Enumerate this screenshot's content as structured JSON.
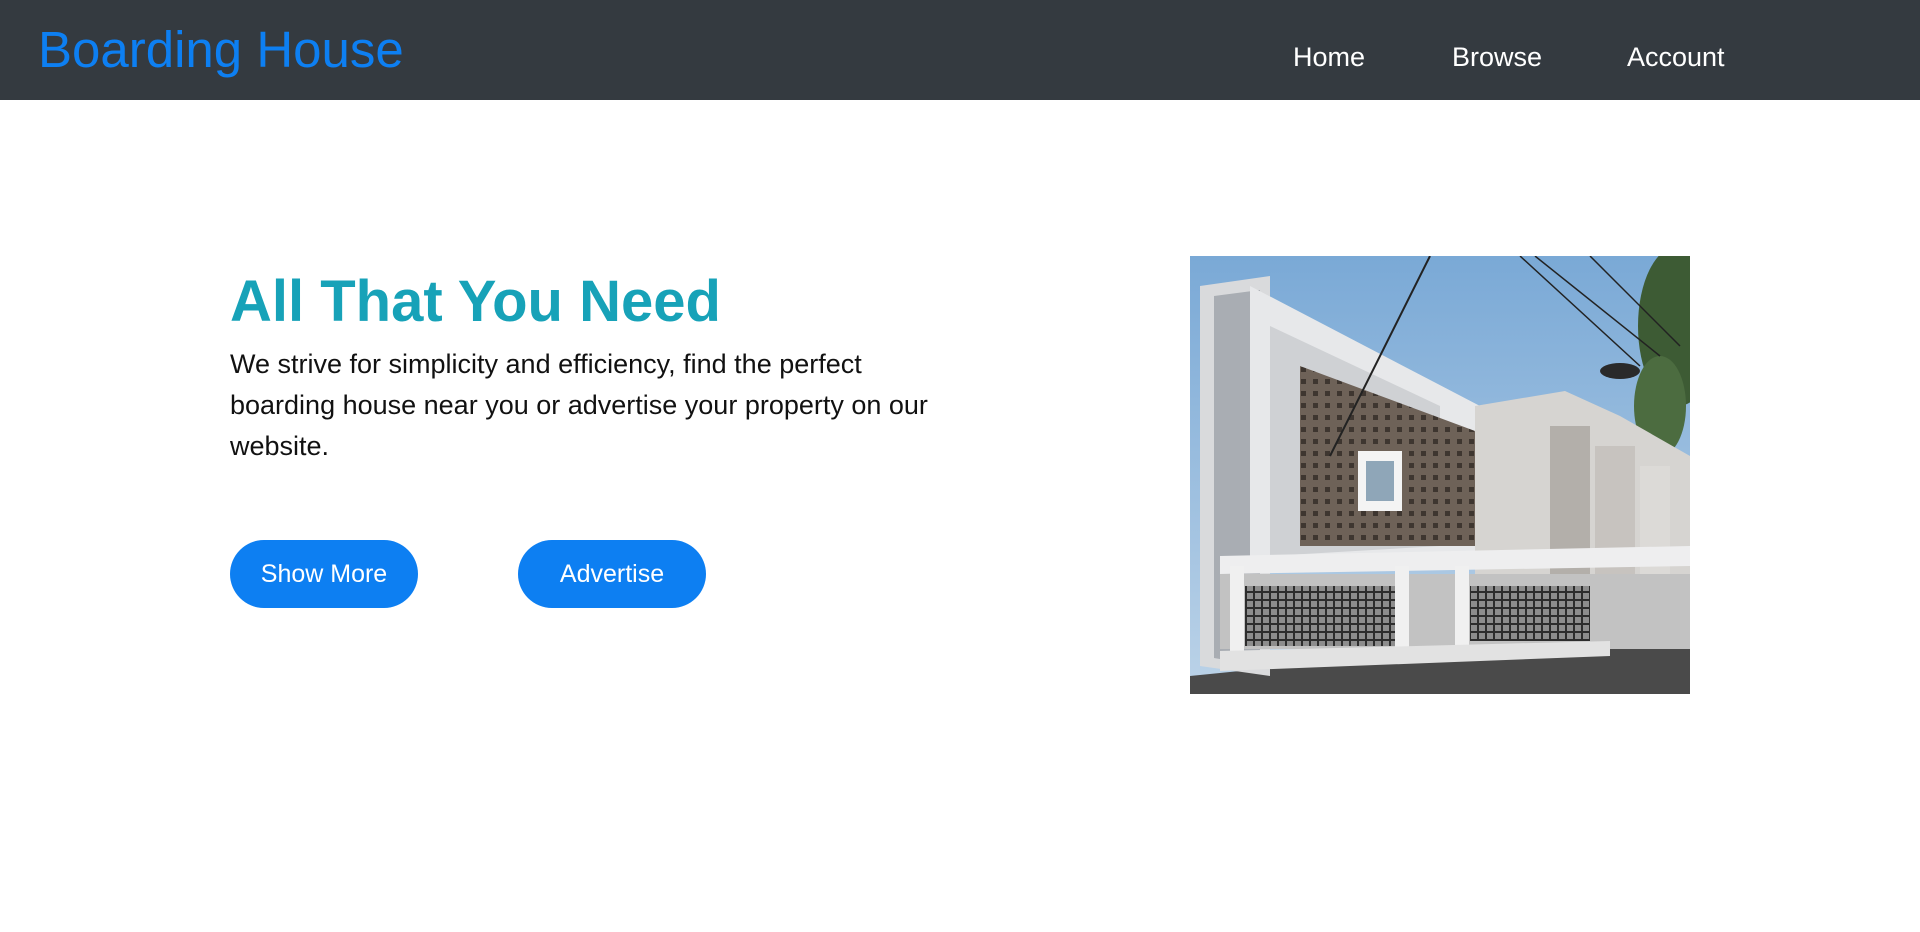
{
  "navbar": {
    "brand": "Boarding House",
    "links": [
      {
        "label": "Home"
      },
      {
        "label": "Browse"
      },
      {
        "label": "Account"
      }
    ]
  },
  "hero": {
    "title": "All That You Need",
    "description": "We strive for simplicity and efficiency, find the perfect boarding house near you or advertise your property on our website.",
    "buttons": {
      "show_more": "Show More",
      "advertise": "Advertise"
    }
  },
  "colors": {
    "navbar_bg": "#343a40",
    "brand": "#0d7ff2",
    "title": "#17a2b8",
    "button": "#0d7ff2"
  },
  "image": {
    "subject": "modern-boarding-house-photo"
  }
}
